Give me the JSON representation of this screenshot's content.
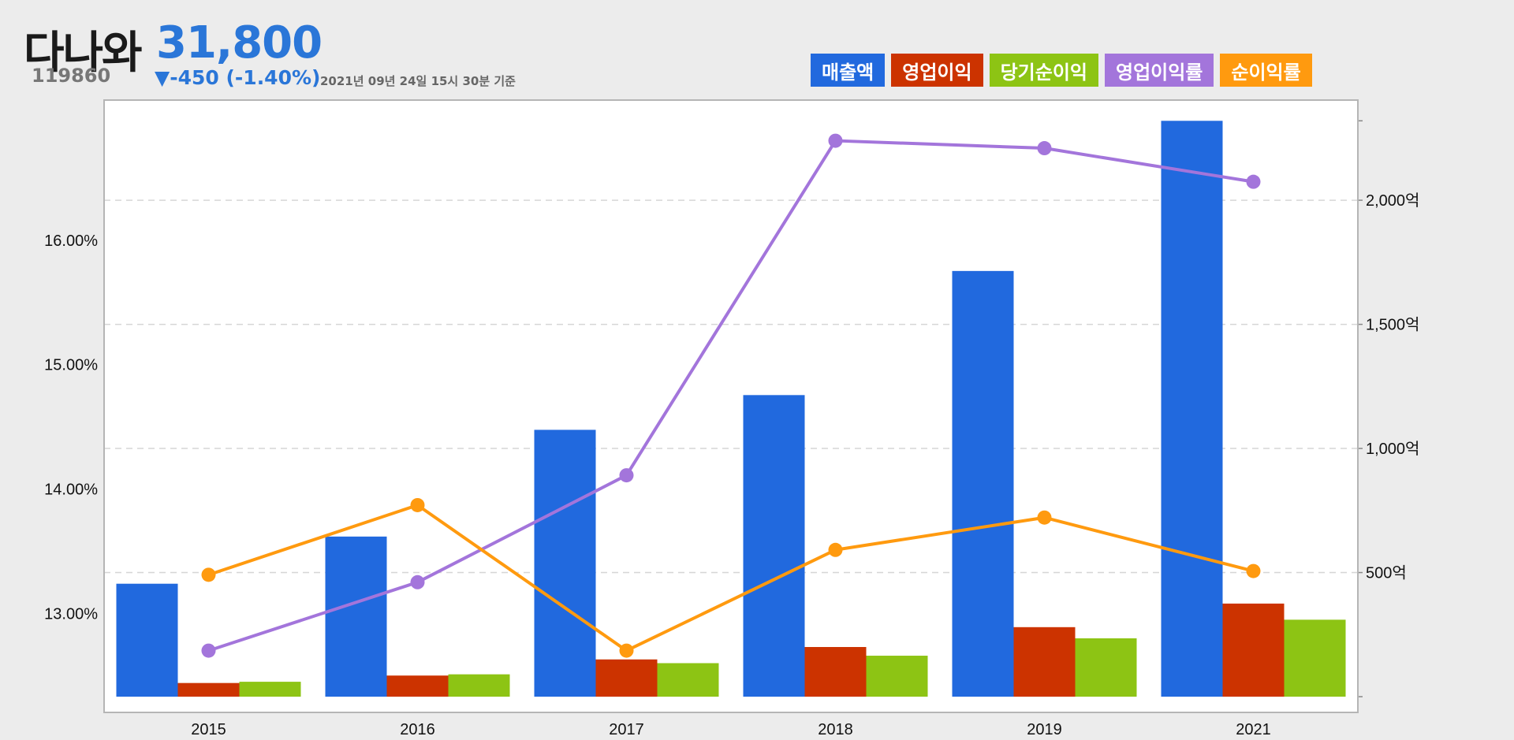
{
  "header": {
    "company_name": "다나와",
    "stock_code": "119860",
    "price": "31,800",
    "change": "▼-450 (-1.40%)",
    "as_of": "2021년 09년 24일 15시 30분 기준"
  },
  "colors": {
    "revenue": "#2169de",
    "operating_profit": "#cc3300",
    "net_income": "#8dc414",
    "operating_margin": "#a375db",
    "net_margin": "#ff9a0f",
    "price_color": "#2a76d8"
  },
  "legend": [
    "매출액",
    "영업이익",
    "당기순이익",
    "영업이익률",
    "순이익률"
  ],
  "chart_data": {
    "type": "bar",
    "categories": [
      "2015",
      "2016",
      "2017",
      "2018",
      "2019",
      "2021"
    ],
    "series": [
      {
        "name": "매출액",
        "kind": "bar",
        "axis": "right",
        "values": [
          455,
          645,
          1075,
          1215,
          1715,
          2320
        ]
      },
      {
        "name": "영업이익",
        "kind": "bar",
        "axis": "right",
        "values": [
          55,
          85,
          150,
          200,
          280,
          375
        ]
      },
      {
        "name": "당기순이익",
        "kind": "bar",
        "axis": "right",
        "values": [
          60,
          90,
          135,
          165,
          235,
          310
        ]
      },
      {
        "name": "영업이익률",
        "kind": "line",
        "axis": "left",
        "values": [
          12.7,
          13.25,
          14.11,
          16.8,
          16.74,
          16.47
        ]
      },
      {
        "name": "순이익률",
        "kind": "line",
        "axis": "left",
        "values": [
          13.31,
          13.87,
          12.7,
          13.51,
          13.77,
          13.34
        ]
      }
    ],
    "left_axis": {
      "ticks": [
        "13.00%",
        "14.00%",
        "15.00%",
        "16.00%"
      ],
      "tick_values": [
        13,
        14,
        15,
        16
      ],
      "ylim": [
        12.33,
        17.0
      ]
    },
    "right_axis": {
      "ticks": [
        "500억",
        "1,000억",
        "1,500억",
        "2,000억"
      ],
      "tick_values": [
        500,
        1000,
        1500,
        2000
      ],
      "ylim": [
        0,
        2340
      ]
    },
    "grid": true
  }
}
